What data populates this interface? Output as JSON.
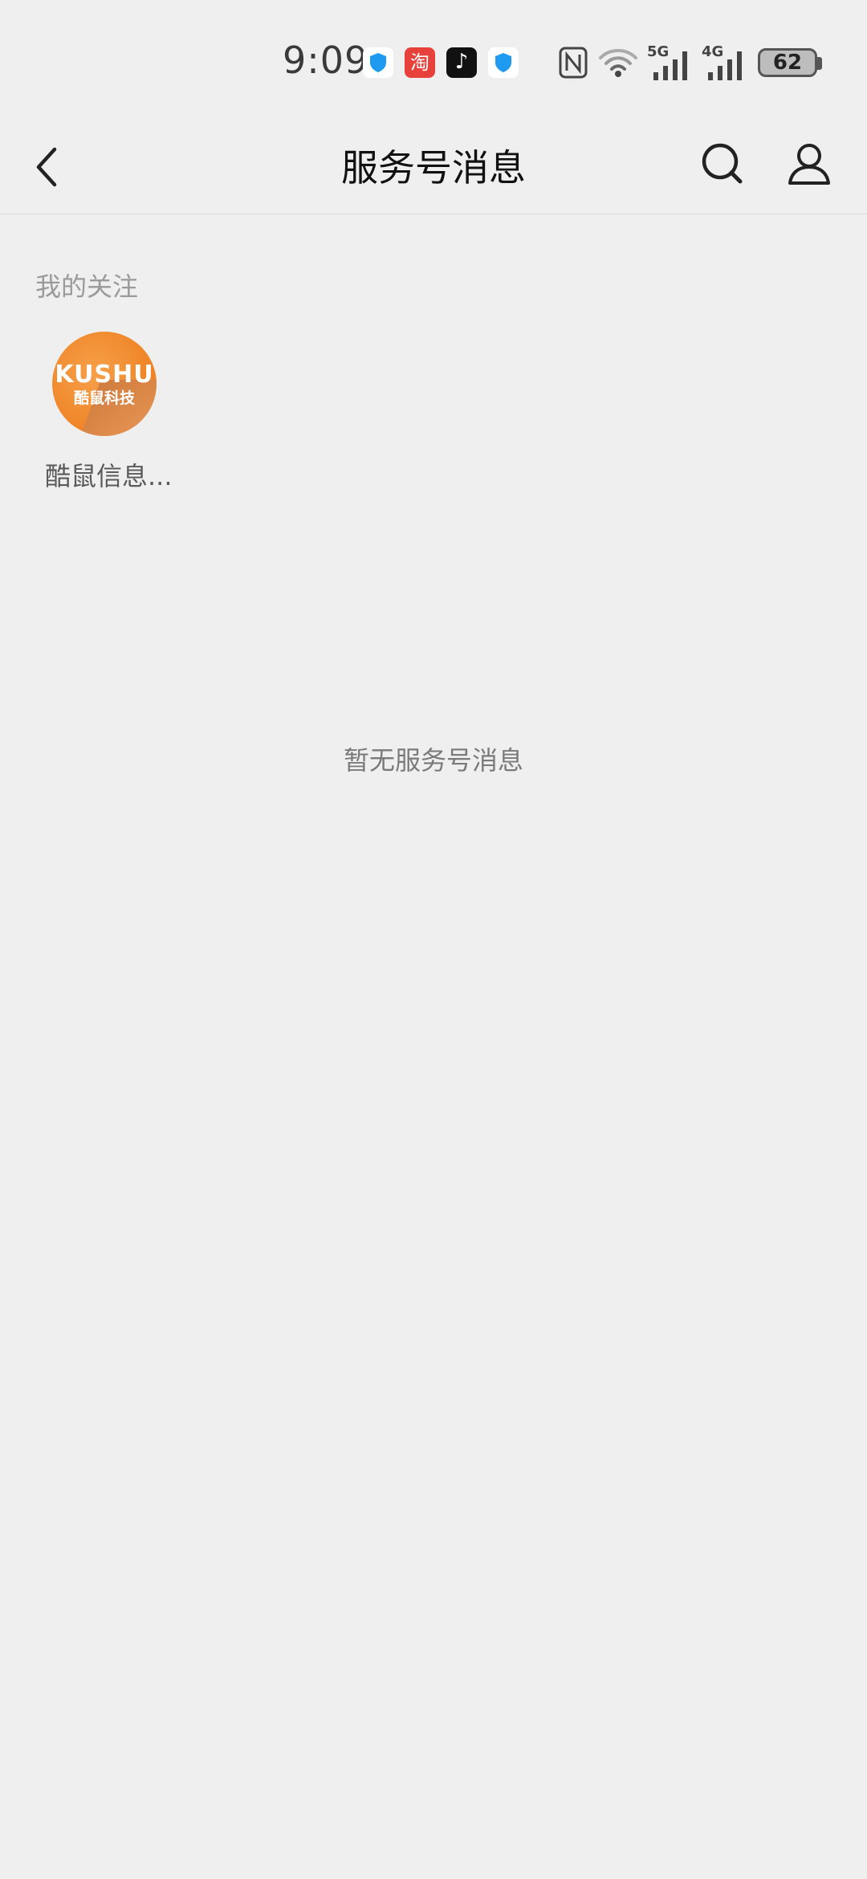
{
  "status_bar": {
    "time": "9:09",
    "app_icons": [
      "shield-icon",
      "taobao-icon",
      "douyin-icon",
      "shield-icon"
    ],
    "taobao_glyph": "淘",
    "douyin_glyph": "♪",
    "network_5g": "5G",
    "network_4g": "4G",
    "battery_level": "62"
  },
  "nav": {
    "title": "服务号消息",
    "back_icon": "chevron-left-icon",
    "search_icon": "search-icon",
    "profile_icon": "person-icon"
  },
  "following": {
    "section_title": "我的关注",
    "items": [
      {
        "name": "酷鼠信息...",
        "avatar_text_top": "KUSHU",
        "avatar_text_bottom": "酷鼠科技"
      }
    ]
  },
  "empty_message": "暂无服务号消息",
  "colors": {
    "background": "#efefef",
    "avatar_orange": "#f0872a",
    "muted_text": "#9a9a9a"
  }
}
